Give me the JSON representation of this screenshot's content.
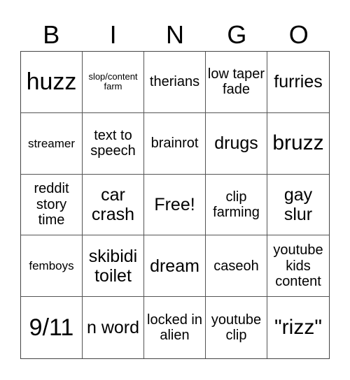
{
  "header": [
    "B",
    "I",
    "N",
    "G",
    "O"
  ],
  "cells": [
    {
      "text": "huzz",
      "size": "s-xxl"
    },
    {
      "text": "slop/content farm",
      "size": "s-xs"
    },
    {
      "text": "therians",
      "size": "s-md"
    },
    {
      "text": "low taper fade",
      "size": "s-md"
    },
    {
      "text": "furries",
      "size": "s-lg"
    },
    {
      "text": "streamer",
      "size": "s-sm"
    },
    {
      "text": "text to speech",
      "size": "s-md"
    },
    {
      "text": "brainrot",
      "size": "s-md"
    },
    {
      "text": "drugs",
      "size": "s-lg"
    },
    {
      "text": "bruzz",
      "size": "s-xl"
    },
    {
      "text": "reddit story time",
      "size": "s-md"
    },
    {
      "text": "car crash",
      "size": "s-lg"
    },
    {
      "text": "Free!",
      "size": "s-lg"
    },
    {
      "text": "clip farming",
      "size": "s-md"
    },
    {
      "text": "gay slur",
      "size": "s-lg"
    },
    {
      "text": "femboys",
      "size": "s-sm"
    },
    {
      "text": "skibidi toilet",
      "size": "s-lg"
    },
    {
      "text": "dream",
      "size": "s-lg"
    },
    {
      "text": "caseoh",
      "size": "s-md"
    },
    {
      "text": "youtube kids content",
      "size": "s-md"
    },
    {
      "text": "9/11",
      "size": "s-xxl"
    },
    {
      "text": "n word",
      "size": "s-lg"
    },
    {
      "text": "locked in alien",
      "size": "s-md"
    },
    {
      "text": "youtube clip",
      "size": "s-md"
    },
    {
      "text": "\"rizz\"",
      "size": "s-xl"
    }
  ]
}
